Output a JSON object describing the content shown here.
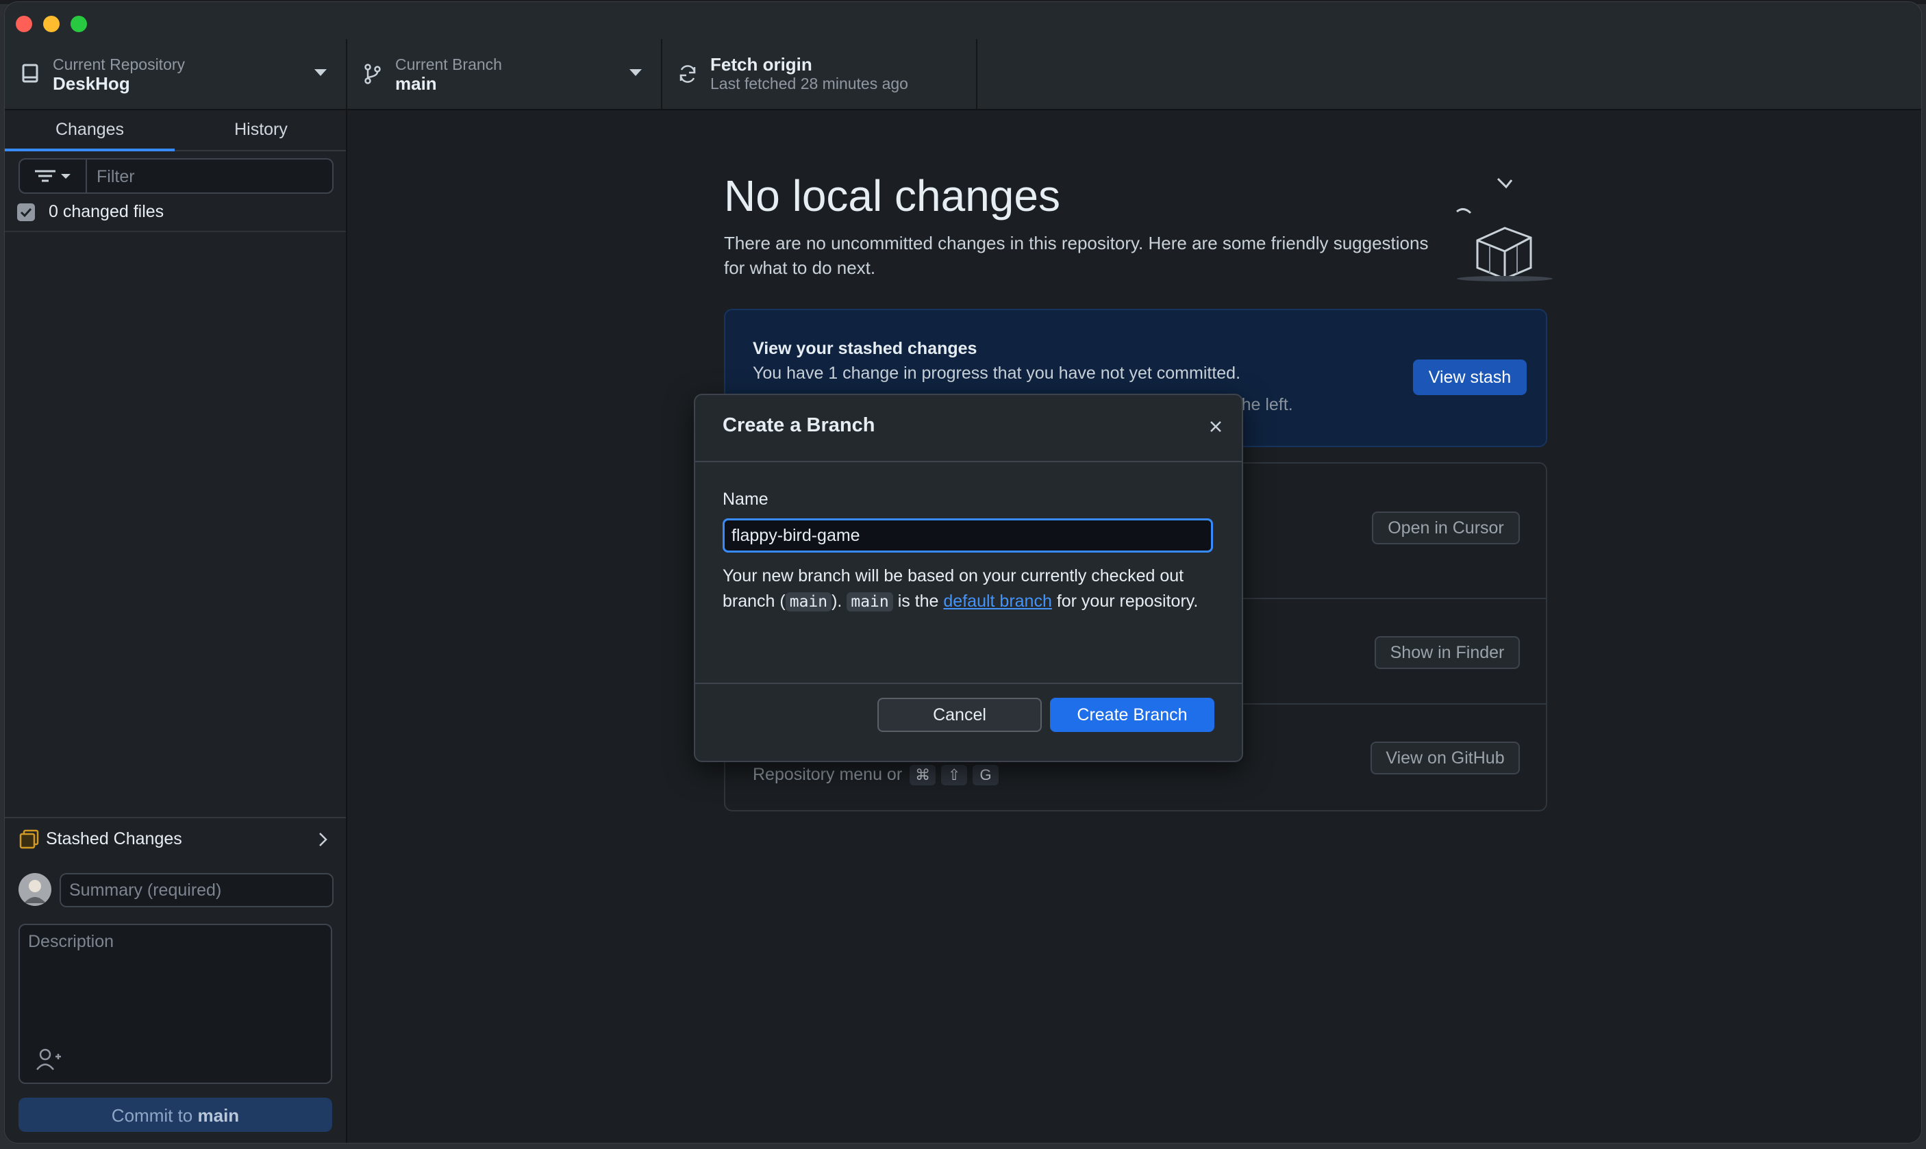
{
  "toolbar": {
    "repository": {
      "label": "Current Repository",
      "value": "DeskHog"
    },
    "branch": {
      "label": "Current Branch",
      "value": "main"
    },
    "fetch": {
      "label": "Fetch origin",
      "status": "Last fetched 28 minutes ago"
    }
  },
  "sidebar": {
    "tabs": [
      {
        "label": "Changes",
        "active": true
      },
      {
        "label": "History",
        "active": false
      }
    ],
    "filter_placeholder": "Filter",
    "changed_files": "0 changed files",
    "stashed_changes": "Stashed Changes",
    "summary_placeholder": "Summary (required)",
    "description_placeholder": "Description",
    "commit_prefix": "Commit to",
    "commit_branch": "main"
  },
  "main": {
    "title": "No local changes",
    "subtitle": "There are no uncommitted changes in this repository. Here are some friendly suggestions for what to do next.",
    "stash_card": {
      "title": "View your stashed changes",
      "description": "You have 1 change in progress that you have not yet committed.",
      "partial_hint": "b to the left.",
      "button": "View stash"
    },
    "actions": {
      "open_editor": "Open in Cursor",
      "show_finder": "Show in Finder",
      "view_github": "View on GitHub",
      "menu_hint": "Repository menu or",
      "shortcut_keys": [
        "⌘",
        "⇧",
        "G"
      ]
    }
  },
  "dialog": {
    "title": "Create a Branch",
    "name_label": "Name",
    "name_value": "flappy-bird-game",
    "desc_part1": "Your new branch will be based on your currently checked out branch (",
    "code1": "main",
    "desc_part2": ").",
    "code2": "main",
    "desc_part3": "is the",
    "link": "default branch",
    "desc_part4": "for your repository.",
    "cancel": "Cancel",
    "create": "Create Branch"
  },
  "colors": {
    "accent": "#1f6feb",
    "link": "#4493f8",
    "background": "#1b1f23"
  }
}
